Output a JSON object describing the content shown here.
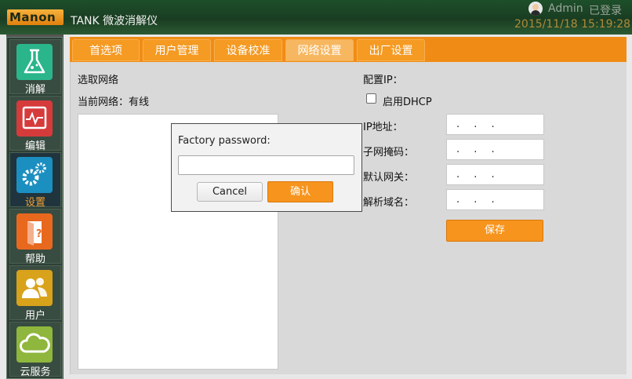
{
  "header": {
    "logo_text": "Manon",
    "title": "TANK 微波消解仪",
    "user": "Admin",
    "status": "已登录",
    "datetime": "2015/11/18 15:19:28"
  },
  "sidebar": {
    "items": [
      {
        "label": "消解",
        "icon": "flask-icon",
        "color": "#2bb58a"
      },
      {
        "label": "编辑",
        "icon": "chart-edit-icon",
        "color": "#d63b3b"
      },
      {
        "label": "设置",
        "icon": "gear-icon",
        "color": "#1b8fc0"
      },
      {
        "label": "帮助",
        "icon": "help-book-icon",
        "color": "#e8681e"
      },
      {
        "label": "用户",
        "icon": "users-icon",
        "color": "#d8a21a"
      },
      {
        "label": "云服务",
        "icon": "cloud-icon",
        "color": "#8fb63d"
      }
    ],
    "active_index": 2
  },
  "tabs": {
    "items": [
      "首选项",
      "用户管理",
      "设备校准",
      "网络设置",
      "出厂设置"
    ],
    "active_index": 3
  },
  "network": {
    "select_label": "选取网络",
    "current_label": "当前网络：有线"
  },
  "config": {
    "title": "配置IP：",
    "dhcp_label": "启用DHCP",
    "dhcp_checked": false,
    "fields": [
      {
        "label": "IP地址：",
        "value": ". . ."
      },
      {
        "label": "子网掩码：",
        "value": ". . ."
      },
      {
        "label": "默认网关：",
        "value": ". . ."
      },
      {
        "label": "解析域名：",
        "value": ". . ."
      }
    ],
    "save_label": "保存"
  },
  "dialog": {
    "title": "Factory password:",
    "password_value": "",
    "cancel_label": "Cancel",
    "ok_label": "确认"
  },
  "colors": {
    "accent": "#f7941d",
    "header_bg": "#1a3d22",
    "sidebar_bg": "#2d3f36"
  }
}
